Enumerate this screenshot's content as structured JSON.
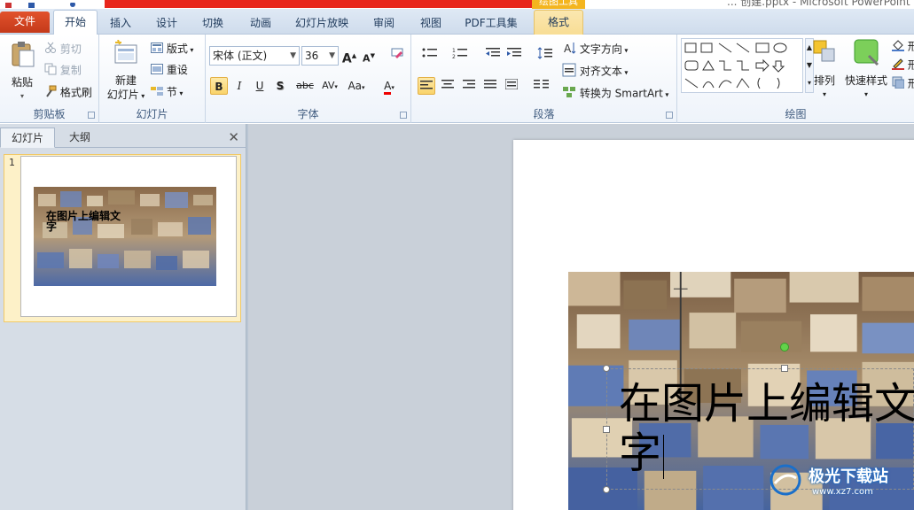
{
  "window": {
    "doc_title": "... 创建.pptx - Microsoft PowerPoint",
    "context_group": "绘图工具"
  },
  "tabs": [
    {
      "label": "文件"
    },
    {
      "label": "开始"
    },
    {
      "label": "插入"
    },
    {
      "label": "设计"
    },
    {
      "label": "切换"
    },
    {
      "label": "动画"
    },
    {
      "label": "幻灯片放映"
    },
    {
      "label": "审阅"
    },
    {
      "label": "视图"
    },
    {
      "label": "PDF工具集"
    },
    {
      "label": "格式"
    }
  ],
  "ribbon": {
    "clipboard": {
      "label": "剪贴板",
      "paste": "粘贴",
      "cut": "剪切",
      "copy": "复制",
      "format_painter": "格式刷"
    },
    "slides": {
      "label": "幻灯片",
      "new_slide_1": "新建",
      "new_slide_2": "幻灯片",
      "layout": "版式",
      "reset": "重设",
      "section": "节"
    },
    "font": {
      "label": "字体",
      "font_name": "宋体 (正文)",
      "font_size": "36",
      "bold": "B",
      "italic": "I",
      "underline": "U",
      "shadow": "S",
      "strike": "abc",
      "spacing": "AV",
      "case": "Aa",
      "color_a": "A"
    },
    "paragraph": {
      "label": "段落",
      "text_direction": "文字方向",
      "align_text": "对齐文本",
      "smartart": "转换为 SmartArt"
    },
    "drawing": {
      "label": "绘图",
      "arrange": "排列",
      "quick_styles": "快速样式",
      "fill": "形",
      "outline": "形",
      "effects": "形"
    }
  },
  "slide_panel": {
    "tab_slides": "幻灯片",
    "tab_outline": "大纲",
    "close": "✕",
    "slide_number": "1",
    "thumb_text_1": "在图片上编辑文",
    "thumb_text_2": "字"
  },
  "slide": {
    "title_line1": "在图片上编辑文",
    "title_line2": "字"
  },
  "watermark": {
    "brand": "极光下载站",
    "url": "www.xz7.com"
  },
  "colors": {
    "file_tab": "#d2452a",
    "title_red": "#e8261c",
    "context_orange": "#f4b51f",
    "selection_green": "#62d34a"
  }
}
